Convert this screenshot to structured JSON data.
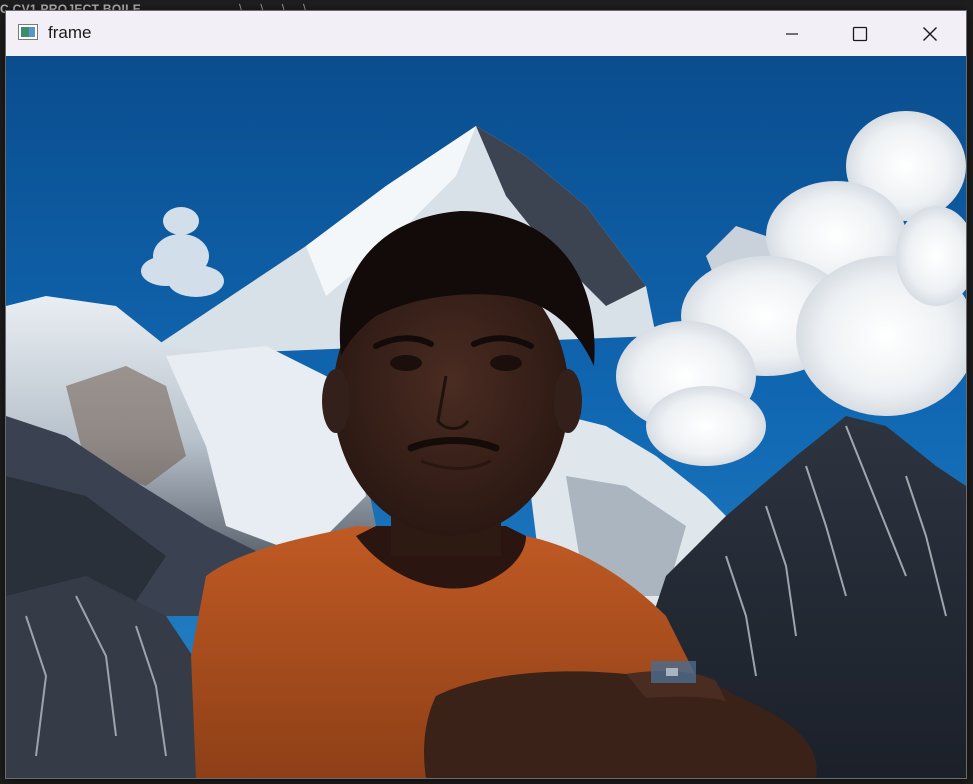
{
  "desktop": {
    "title": "C  CV1 PROJECT  BOILE",
    "path": "⟩ ...  ⟩  ...  ⟩  ...  ⟩"
  },
  "window": {
    "title": "frame",
    "controls": {
      "minimize_icon": "minimize-icon",
      "maximize_icon": "maximize-icon",
      "close_icon": "close-icon"
    }
  },
  "colors": {
    "titlebar": "#f3eff7",
    "sky": "#0e5fa7",
    "shirt": "#b2521f",
    "snow": "#eef2f6"
  }
}
